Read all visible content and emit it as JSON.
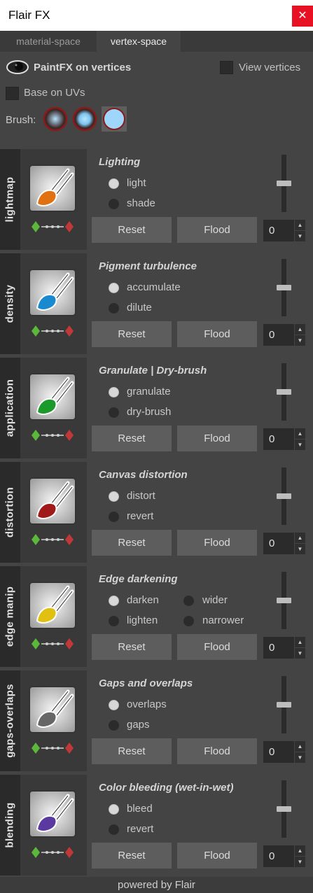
{
  "window": {
    "title": "Flair FX",
    "close_glyph": "✕"
  },
  "tabs": [
    {
      "label": "material-space",
      "active": false
    },
    {
      "label": "vertex-space",
      "active": true
    }
  ],
  "top": {
    "eye_icon": "eye-icon",
    "paintfx_label": "PaintFX on vertices",
    "view_vertices_label": "View vertices",
    "base_on_uvs_label": "Base on UVs",
    "brush_label": "Brush:",
    "brushes": [
      "brush-soft",
      "brush-medium",
      "brush-hard"
    ]
  },
  "sections": [
    {
      "tab_label": "lightmap",
      "title": "Lighting",
      "icon": "lightmap-brush-icon",
      "brush_color": "#e07010",
      "radios": [
        {
          "label": "light",
          "checked": true
        },
        {
          "label": "shade",
          "checked": false
        }
      ],
      "reset_label": "Reset",
      "flood_label": "Flood",
      "value": "0",
      "slider_level": 0.5
    },
    {
      "tab_label": "density",
      "title": "Pigment turbulence",
      "icon": "density-brush-icon",
      "brush_color": "#1a8ad0",
      "radios": [
        {
          "label": "accumulate",
          "checked": true
        },
        {
          "label": "dilute",
          "checked": false
        }
      ],
      "reset_label": "Reset",
      "flood_label": "Flood",
      "value": "0",
      "slider_level": 0.5
    },
    {
      "tab_label": "application",
      "title": "Granulate | Dry-brush",
      "icon": "application-brush-icon",
      "brush_color": "#1a9a2a",
      "radios": [
        {
          "label": "granulate",
          "checked": true
        },
        {
          "label": "dry-brush",
          "checked": false
        }
      ],
      "reset_label": "Reset",
      "flood_label": "Flood",
      "value": "0",
      "slider_level": 0.5
    },
    {
      "tab_label": "distortion",
      "title": "Canvas distortion",
      "icon": "distortion-brush-icon",
      "brush_color": "#a01a1a",
      "radios": [
        {
          "label": "distort",
          "checked": true
        },
        {
          "label": "revert",
          "checked": false
        }
      ],
      "reset_label": "Reset",
      "flood_label": "Flood",
      "value": "0",
      "slider_level": 0.5
    },
    {
      "tab_label": "edge manip",
      "title": "Edge darkening",
      "icon": "edge-manip-brush-icon",
      "brush_color": "#e0c010",
      "radios": [
        {
          "label": "darken",
          "checked": true
        },
        {
          "label": "lighten",
          "checked": false
        },
        {
          "label": "wider",
          "checked": false
        },
        {
          "label": "narrower",
          "checked": false
        }
      ],
      "reset_label": "Reset",
      "flood_label": "Flood",
      "value": "0",
      "slider_level": 0.5
    },
    {
      "tab_label": "gaps-overlaps",
      "title": "Gaps and overlaps",
      "icon": "gaps-overlaps-brush-icon",
      "brush_color": "#666666",
      "radios": [
        {
          "label": "overlaps",
          "checked": true
        },
        {
          "label": "gaps",
          "checked": false
        }
      ],
      "reset_label": "Reset",
      "flood_label": "Flood",
      "value": "0",
      "slider_level": 0.5
    },
    {
      "tab_label": "blending",
      "title": "Color bleeding (wet-in-wet)",
      "icon": "blending-brush-icon",
      "brush_color": "#5a3aa0",
      "radios": [
        {
          "label": "bleed",
          "checked": true
        },
        {
          "label": "revert",
          "checked": false
        }
      ],
      "reset_label": "Reset",
      "flood_label": "Flood",
      "value": "0",
      "slider_level": 0.5
    }
  ],
  "spin_up_glyph": "▲",
  "spin_down_glyph": "▼",
  "footer": "powered by Flair",
  "colors": {
    "accent_red": "#e81123",
    "diamond_green": "#5cb83a",
    "diamond_red": "#c03838"
  }
}
